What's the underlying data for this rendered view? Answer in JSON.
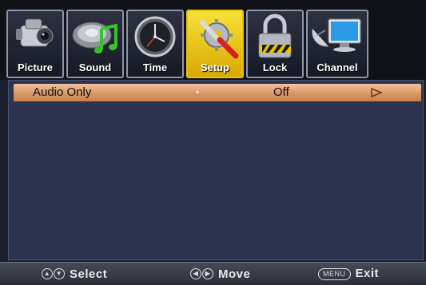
{
  "tabs": [
    {
      "label": "Picture",
      "icon": "camcorder-icon",
      "active": false
    },
    {
      "label": "Sound",
      "icon": "speaker-music-note-icon",
      "active": false
    },
    {
      "label": "Time",
      "icon": "clock-icon",
      "active": false
    },
    {
      "label": "Setup",
      "icon": "wrench-screwdriver-gear-icon",
      "active": true
    },
    {
      "label": "Lock",
      "icon": "padlock-icon",
      "active": false
    },
    {
      "label": "Channel",
      "icon": "satellite-dish-monitor-icon",
      "active": false
    }
  ],
  "menu": {
    "items": [
      {
        "label": "Audio Only",
        "value": "Off",
        "selected": true
      }
    ]
  },
  "footer": {
    "select_label": "Select",
    "move_label": "Move",
    "menu_key": "MENU",
    "exit_label": "Exit"
  },
  "colors": {
    "active_tab": "#f2d21a",
    "selected_row": "#d99766",
    "content_bg": "#2c3450"
  }
}
